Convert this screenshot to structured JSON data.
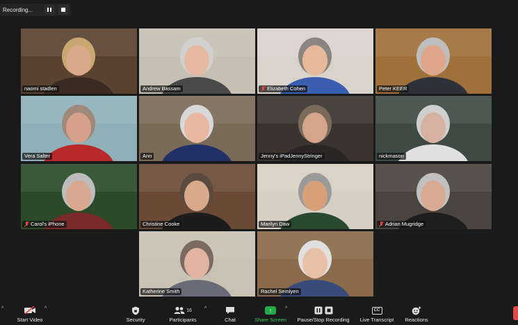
{
  "recording": {
    "status": "Recording..."
  },
  "participants": [
    {
      "name": "naomi stadlen",
      "muted": false,
      "active": false,
      "bg": "#5a4230",
      "face": "#d9a98a",
      "hair": "#c9a870",
      "shirt": "#3a2a22"
    },
    {
      "name": "Andrew Bassam",
      "muted": false,
      "active": false,
      "bg": "#c6c0b4",
      "face": "#e5b9a0",
      "hair": "#d0d0d0",
      "shirt": "#4a4a4a"
    },
    {
      "name": "Elizabeth Cohen",
      "muted": true,
      "active": false,
      "bg": "#d8d4cc",
      "face": "#e8b89a",
      "hair": "#8a8580",
      "shirt": "#3b5fb0"
    },
    {
      "name": "Peter KEER",
      "muted": false,
      "active": false,
      "bg": "#a0703a",
      "face": "#e0a68a",
      "hair": "#bdbdbd",
      "shirt": "#2c3238"
    },
    {
      "name": "Vera Salter",
      "muted": false,
      "active": true,
      "bg": "#8fb0b8",
      "face": "#d7a08a",
      "hair": "#a0887a",
      "shirt": "#b82a2a"
    },
    {
      "name": "Ann",
      "muted": false,
      "active": false,
      "bg": "#7a6a58",
      "face": "#eab8a0",
      "hair": "#d8d8d8",
      "shirt": "#223068"
    },
    {
      "name": "Jenny's iPadJennyStringer",
      "muted": false,
      "active": false,
      "bg": "#3a3430",
      "face": "#d6a48a",
      "hair": "#7a6a5a",
      "shirt": "#2a2626"
    },
    {
      "name": "nickmason",
      "muted": false,
      "active": false,
      "bg": "#3e4a44",
      "face": "#d6b0a0",
      "hair": "#cfcfcf",
      "shirt": "#e0e0e0"
    },
    {
      "name": "Carol's iPhone",
      "muted": true,
      "active": false,
      "bg": "#2a4a2a",
      "face": "#d8a890",
      "hair": "#bcbcbc",
      "shirt": "#7a2a2a"
    },
    {
      "name": "Christine Cooke",
      "muted": false,
      "active": false,
      "bg": "#6a4a36",
      "face": "#d9a98c",
      "hair": "#5a4a40",
      "shirt": "#1c1c1c"
    },
    {
      "name": "Marilyn Daw",
      "muted": false,
      "active": false,
      "bg": "#d6d0c4",
      "face": "#d8a078",
      "hair": "#9a9a9a",
      "shirt": "#2a4a30"
    },
    {
      "name": "Adrian Mugridge",
      "muted": true,
      "active": false,
      "bg": "#4a4440",
      "face": "#d8aa94",
      "hair": "#c0c0c0",
      "shirt": "#1e1e1e"
    },
    {
      "name": "Katherine Smith",
      "muted": false,
      "active": false,
      "bg": "#c8c2b4",
      "face": "#e0b4a0",
      "hair": "#7a6a60",
      "shirt": "#6a6a78"
    },
    {
      "name": "Rachel Semlyen",
      "muted": false,
      "active": false,
      "bg": "#8a6a4a",
      "face": "#e8c0a8",
      "hair": "#e0e0e0",
      "shirt": "#3a4a7a"
    }
  ],
  "toolbar": {
    "start_video": "Start Video",
    "security": "Security",
    "participants": "Participants",
    "participants_count": "16",
    "chat": "Chat",
    "share_screen": "Share Screen",
    "pause_stop_recording": "Pause/Stop Recording",
    "live_transcript": "Live Transcript",
    "live_transcript_icon_text": "CC",
    "reactions": "Reactions"
  }
}
